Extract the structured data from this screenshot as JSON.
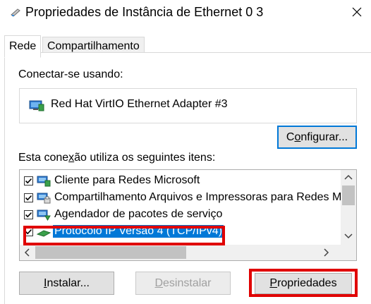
{
  "window": {
    "title": "Propriedades de Instância de Ethernet 0 3",
    "close_glyph": "✕"
  },
  "tabs": [
    {
      "label": "Rede",
      "active": true
    },
    {
      "label": "Compartilhamento",
      "active": false
    }
  ],
  "connect_using": {
    "label": "Conectar-se usando:",
    "adapter_name": "Red Hat VirtIO Ethernet Adapter #3",
    "configure_button": {
      "pre": "C",
      "underlined": "o",
      "post": "nfigurar..."
    }
  },
  "items": {
    "label_pre": "Esta cone",
    "label_underlined": "x",
    "label_post": "ão utiliza os seguintes itens:",
    "list": [
      {
        "label": "Cliente para Redes Microsoft",
        "checked": true,
        "icon": "network-client-icon",
        "selected": false
      },
      {
        "label": "Compartilhamento Arquivos e Impressoras para Redes M",
        "checked": true,
        "icon": "file-printer-sharing-icon",
        "selected": false
      },
      {
        "label": "Agendador de pacotes de serviço",
        "checked": true,
        "icon": "qos-scheduler-icon",
        "selected": false
      },
      {
        "label": "Protocolo IP Versão 4 (TCP/IPv4)",
        "checked": true,
        "icon": "protocol-icon",
        "selected": true
      }
    ]
  },
  "buttons": {
    "install": {
      "underlined": "I",
      "post": "nstalar..."
    },
    "uninstall": {
      "pre": "",
      "underlined": "D",
      "post": "esinstalar"
    },
    "properties": {
      "underlined": "P",
      "post": "ropriedades"
    }
  },
  "highlight_color": "#e00000",
  "accent_color": "#0078d7"
}
